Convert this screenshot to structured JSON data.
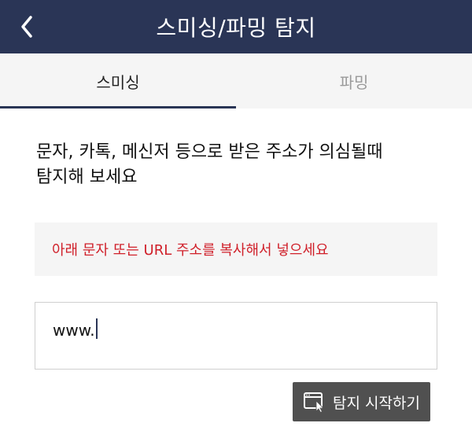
{
  "header": {
    "title": "스미싱/파밍 탐지",
    "back_icon": "chevron-left-icon"
  },
  "tabs": [
    {
      "label": "스미싱",
      "active": true
    },
    {
      "label": "파밍",
      "active": false
    }
  ],
  "main": {
    "description_line1": "문자, 카톡, 메신저 등으로 받은 주소가 의심될때",
    "description_line2": "탐지해 보세요",
    "notice": "아래 문자 또는 URL 주소를 복사해서 넣으세요",
    "input_value": "www.",
    "start_button": {
      "label": "탐지 시작하기",
      "icon": "browser-cursor-icon"
    }
  },
  "colors": {
    "header_bg": "#2a3556",
    "notice_text": "#d0202a",
    "button_bg": "#505050"
  }
}
